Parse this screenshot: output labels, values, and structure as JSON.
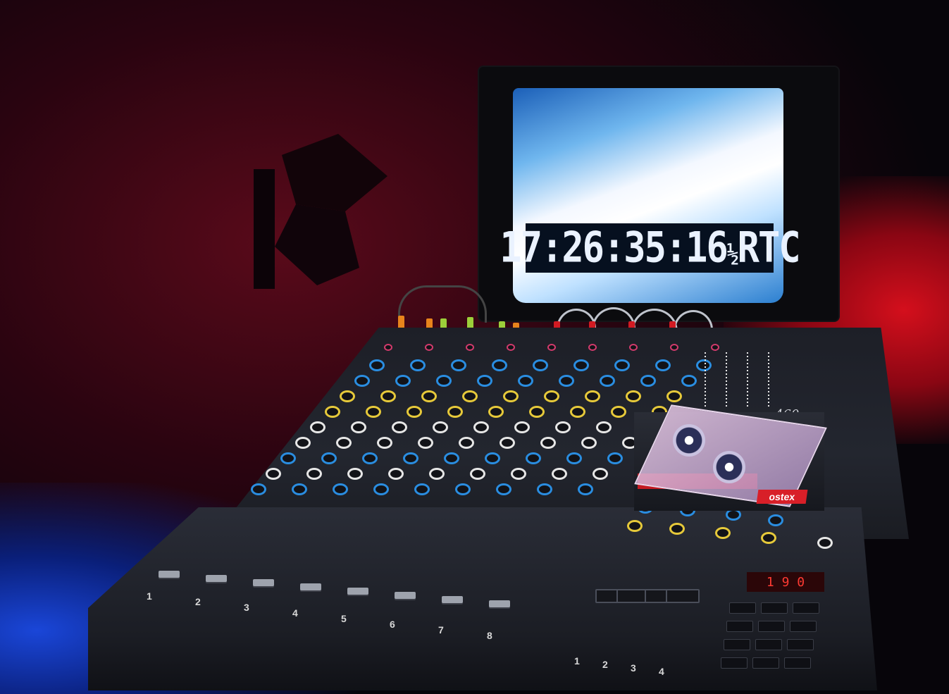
{
  "monitor": {
    "timecode": "17:26:35:16",
    "timecode_suffix": "RTC",
    "timecode_fraction_mark": "½"
  },
  "deck": {
    "model_number": "460",
    "brand_fragment": "ostex",
    "counter": "1 9 0"
  },
  "channels": [
    "1",
    "2",
    "3",
    "4",
    "5",
    "6",
    "7",
    "8"
  ],
  "masters": [
    "1",
    "2",
    "3",
    "4"
  ],
  "colors": {
    "backdrop_red": "#d40f1c",
    "floor_blue": "#1a46d8",
    "knob_blue": "#2a8de0",
    "knob_yellow": "#e6c93a",
    "knob_white": "#e6e6e6",
    "led_red": "#ff3a32"
  }
}
